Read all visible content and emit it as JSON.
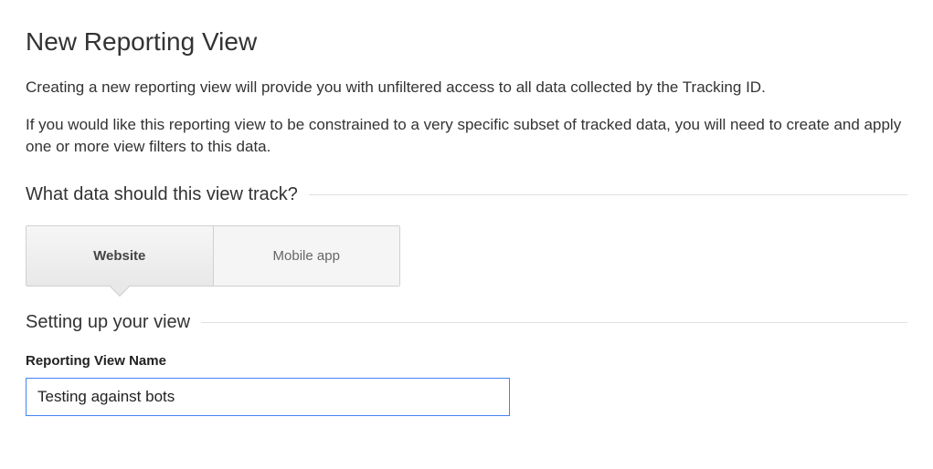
{
  "page": {
    "title": "New Reporting View",
    "intro1": "Creating a new reporting view will provide you with unfiltered access to all data collected by the Tracking ID.",
    "intro2": "If you would like this reporting view to be constrained to a very specific subset of tracked data, you will need to create and apply one or more view filters to this data."
  },
  "section_track": {
    "heading": "What data should this view track?",
    "tabs": {
      "website": "Website",
      "mobile_app": "Mobile app"
    }
  },
  "section_setup": {
    "heading": "Setting up your view",
    "field_label": "Reporting View Name",
    "field_value": "Testing against bots"
  }
}
